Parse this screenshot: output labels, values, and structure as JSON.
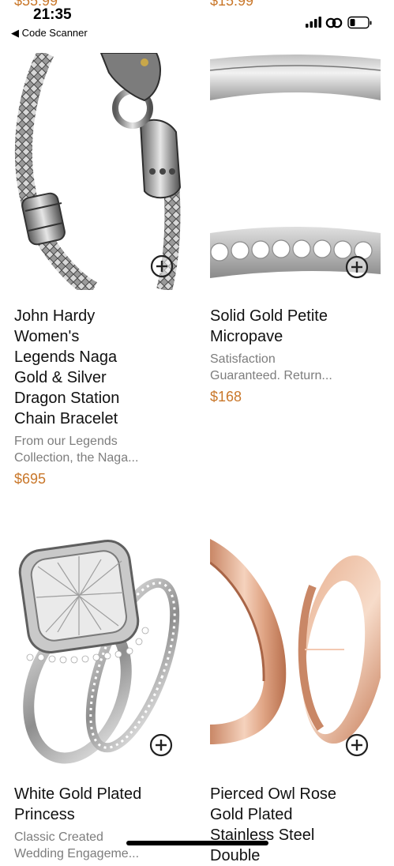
{
  "status_bar": {
    "time": "21:35",
    "back_label": "◀ Code Scanner",
    "prev_prices": [
      "$55.99",
      "$15.99"
    ]
  },
  "products": [
    {
      "title": "John Hardy Women's Legends Naga Gold & Silver Dragon Station Chain Bracelet",
      "title_lines": [
        "John Hardy",
        "Women's",
        "Legends Naga",
        "Gold & Silver",
        "Dragon Station",
        "Chain Bracelet"
      ],
      "description_lines": [
        "From our Legends",
        "Collection, the Naga..."
      ],
      "price": "$695",
      "image": "silver-dragon-chain-bracelet",
      "add_icon": "plus-circle-icon"
    },
    {
      "title": "Solid Gold Petite Micropave",
      "title_lines": [
        "Solid Gold Petite",
        "Micropave"
      ],
      "description_lines": [
        "Satisfaction",
        "Guaranteed. Return..."
      ],
      "price": "$168",
      "image": "micropave-band-ring",
      "add_icon": "plus-circle-icon"
    },
    {
      "title": "White Gold Plated Princess",
      "title_lines": [
        "White Gold Plated",
        "Princess"
      ],
      "description_lines": [
        "Classic Created",
        "Wedding Engageme..."
      ],
      "price": "",
      "image": "cushion-cut-diamond-ring-set",
      "add_icon": "plus-circle-icon"
    },
    {
      "title": "Pierced Owl Rose Gold Plated Stainless Steel Double",
      "title_lines": [
        "Pierced Owl Rose",
        "Gold Plated",
        "Stainless Steel",
        "Double"
      ],
      "description_lines": [],
      "price": "",
      "image": "rose-gold-ear-tunnels",
      "add_icon": "plus-circle-icon"
    }
  ],
  "colors": {
    "price": "#c9772a",
    "description": "#7d7d7d",
    "title": "#111111"
  }
}
